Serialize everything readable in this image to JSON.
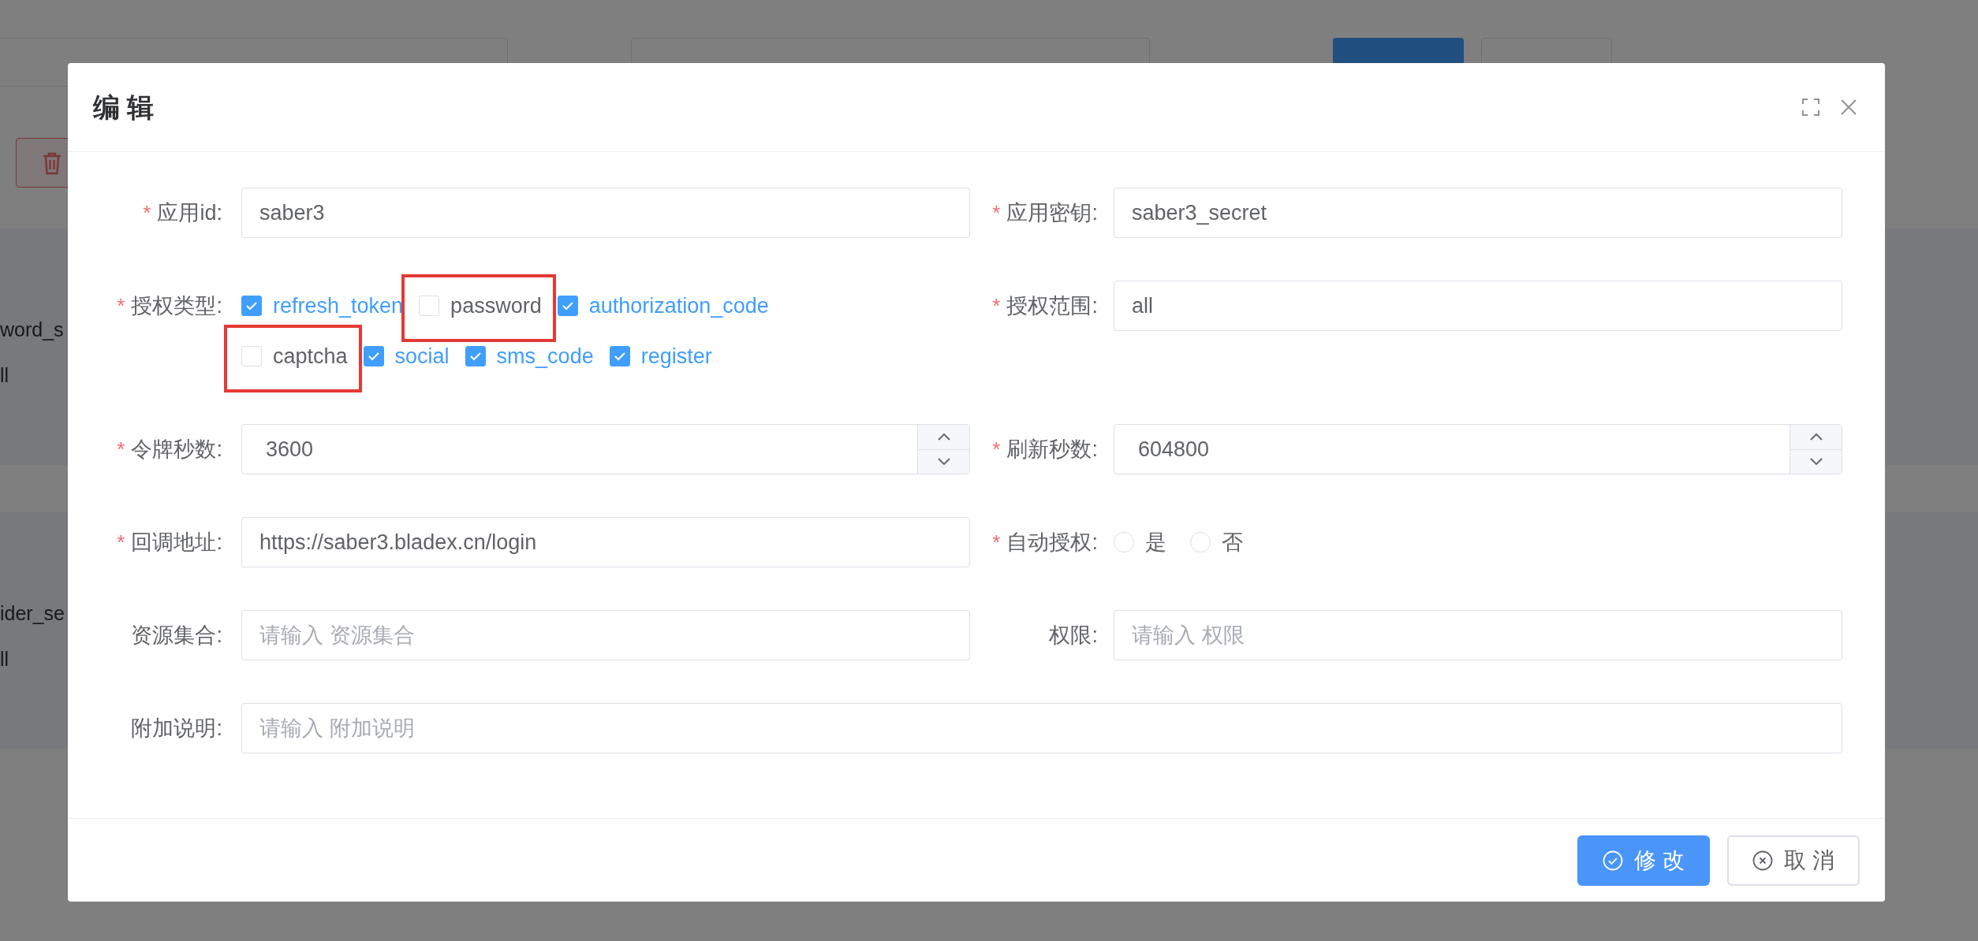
{
  "background_page": {
    "rows": [
      {
        "column_1": "word_s",
        "column_2": "ll"
      },
      {
        "column_1": "ider_se",
        "column_2": "ll"
      }
    ]
  },
  "dialog": {
    "title": "编 辑",
    "fields": [
      {
        "kind": "text",
        "label": "应用id:",
        "required_mark": "*",
        "value": "saber3"
      },
      {
        "kind": "text",
        "label": "应用密钥:",
        "required_mark": "*",
        "value": "saber3_secret"
      },
      {
        "kind": "checkboxes",
        "label": "授权类型:",
        "required_mark": "*",
        "options": [
          {
            "label": "refresh_token",
            "checked": true,
            "highlighted": false
          },
          {
            "label": "password",
            "checked": false,
            "highlighted": true
          },
          {
            "label": "authorization_code",
            "checked": true,
            "highlighted": false
          },
          {
            "label": "captcha",
            "checked": false,
            "highlighted": true
          },
          {
            "label": "social",
            "checked": true,
            "highlighted": false
          },
          {
            "label": "sms_code",
            "checked": true,
            "highlighted": false
          },
          {
            "label": "register",
            "checked": true,
            "highlighted": false
          }
        ]
      },
      {
        "kind": "text",
        "label": "授权范围:",
        "required_mark": "*",
        "value": "all"
      },
      {
        "kind": "number",
        "label": "令牌秒数:",
        "required_mark": "*",
        "value": "3600"
      },
      {
        "kind": "number",
        "label": "刷新秒数:",
        "required_mark": "*",
        "value": "604800"
      },
      {
        "kind": "text",
        "label": "回调地址:",
        "required_mark": "*",
        "value": "https://saber3.bladex.cn/login"
      },
      {
        "kind": "radio",
        "label": "自动授权:",
        "required_mark": "*",
        "options": [
          {
            "label": "是",
            "selected": false
          },
          {
            "label": "否",
            "selected": false
          }
        ]
      },
      {
        "kind": "text",
        "label": "资源集合:",
        "placeholder": "请输入 资源集合"
      },
      {
        "kind": "text",
        "label": "权限:",
        "placeholder": "请输入 权限"
      },
      {
        "kind": "text",
        "label": "附加说明:",
        "placeholder": "请输入 附加说明",
        "full_width": true
      }
    ],
    "buttons": [
      {
        "kind": "primary",
        "label": "修 改"
      },
      {
        "kind": "plain",
        "label": "取 消"
      }
    ]
  }
}
